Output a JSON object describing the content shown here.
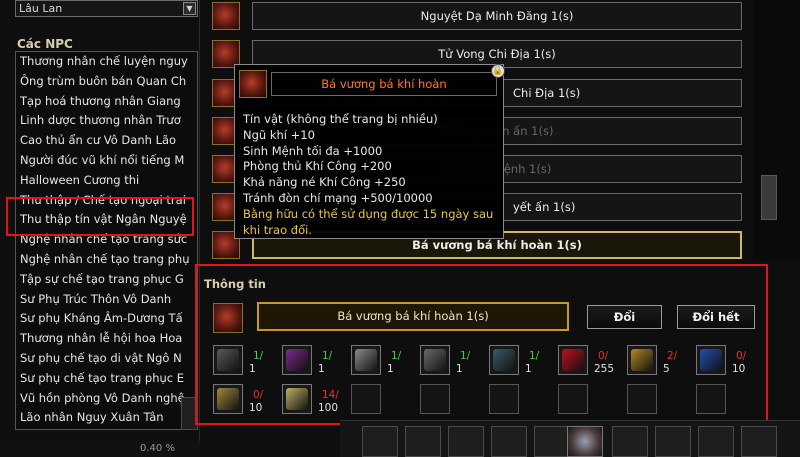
{
  "sidebar": {
    "map_value": "Lâu Lan",
    "npc_title": "Các NPC",
    "npcs": [
      "Thương nhân chế luyện nguy",
      "Ông trùm buôn bán Quan Ch",
      "Tạp hoá thương nhân Giang",
      "Linh dược thương nhân Trươ",
      "Cao thủ ẩn cư Vô Danh Lão",
      "Người đúc vũ khí nổi tiếng M",
      "Halloween Cương thi",
      "Thu thập / Chế tạo ngoại trai",
      "Thu thập tín vật Ngân Nguyệ",
      "Nghệ nhân chế tạo trang sức",
      "Nghệ nhân chế tạo trang phụ",
      "Tập sự chế tạo trang phục G",
      "Sư Phụ Trúc Thôn Vô Danh",
      "Sư phụ Kháng Âm-Dương Tấ",
      "Thương nhân lễ hội hoa Hoa",
      "Sư phụ chế tạo di vật Ngô N",
      "Sư phụ chế tạo trang phục E",
      "Vũ hồn phòng Vô Danh nghệ",
      "Lão nhân Nguy Xuân Tân"
    ],
    "status_text": "0.40 %"
  },
  "items": [
    "Nguyệt Dạ Minh Đăng 1(s)",
    "Tử Vong Chi Địa 1(s)",
    "Chi Địa 1(s)",
    "Thông thiên ấn 1(s)",
    "Thông du lệnh 1(s)",
    "yết ấn 1(s)",
    "Bá vương bá khí hoàn 1(s)"
  ],
  "info": {
    "title": "Thông tin",
    "selected_name": "Bá vương bá khí hoàn 1(s)",
    "exchange_label": "Đổi",
    "exchange_all_label": "Đổi hết",
    "materials": [
      {
        "top": "1/",
        "bottom": "1",
        "color": "#5a5a5a"
      },
      {
        "top": "1/",
        "bottom": "1",
        "color": "#7a2a8a"
      },
      {
        "top": "1/",
        "bottom": "1",
        "color": "#8a8a8a"
      },
      {
        "top": "1/",
        "bottom": "1",
        "color": "#6a6a6a"
      },
      {
        "top": "1/",
        "bottom": "1",
        "color": "#3a5a6a"
      },
      {
        "top": "0/",
        "bottom": "255",
        "color": "#c01020"
      },
      {
        "top": "2/",
        "bottom": "5",
        "color": "#b08a20"
      },
      {
        "top": "0/",
        "bottom": "10",
        "color": "#2050b0"
      },
      {
        "top": "0/",
        "bottom": "10",
        "color": "#a08840"
      },
      {
        "top": "14/",
        "bottom": "100",
        "color": "#c0b060"
      }
    ],
    "colors": {
      "ok": "#3fd13f",
      "missing": "#e83030"
    }
  },
  "tooltip": {
    "title": "Bá vương bá khí hoàn",
    "lines": [
      {
        "text": "Tín vật (không thể trang bị nhiều)",
        "color": "#e8e8e8"
      },
      {
        "text": "Ngũ khí +10",
        "color": "#e8e8e8"
      },
      {
        "text": "Sinh Mệnh tối đa +1000",
        "color": "#e8e8e8"
      },
      {
        "text": "Phòng thủ Khí Công +200",
        "color": "#e8e8e8"
      },
      {
        "text": "Khả năng né Khí Công +250",
        "color": "#e8e8e8"
      },
      {
        "text": "Tránh đòn chí mạng +500/10000",
        "color": "#e8e8e8"
      },
      {
        "text": "Bằng hữu có thể sử dụng được 15 ngày sau",
        "color": "#e6c84a"
      },
      {
        "text": "khi trao đổi.",
        "color": "#e6c84a"
      }
    ]
  }
}
